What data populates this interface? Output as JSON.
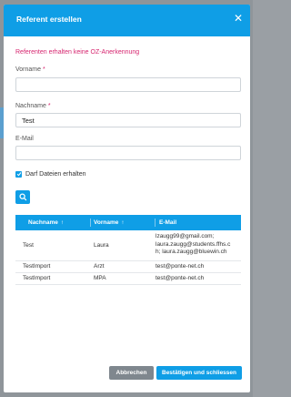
{
  "modal": {
    "title": "Referent erstellen",
    "close_icon": "close-icon",
    "warning": "Referenten erhalten keine OZ-Anerkennung"
  },
  "form": {
    "vorname": {
      "label": "Vorname",
      "required_mark": "*",
      "value": ""
    },
    "nachname": {
      "label": "Nachname",
      "required_mark": "*",
      "value": "Test"
    },
    "email": {
      "label": "E-Mail",
      "value": ""
    },
    "checkbox": {
      "label": "Darf Dateien erhalten",
      "checked": true
    }
  },
  "search_button": {
    "icon": "search-icon"
  },
  "table": {
    "headers": [
      {
        "label": "Nachname",
        "sort_icon": "↑"
      },
      {
        "label": "Vorname",
        "sort_icon": "↑"
      },
      {
        "label": "E-Mail"
      }
    ],
    "rows": [
      {
        "nachname": "Test",
        "vorname": "Laura",
        "email_lines": [
          "lzaugg99@gmail.com;",
          "laura.zaugg@students.ffhs.c",
          "h; laura.zaugg@bluewin.ch"
        ]
      },
      {
        "nachname": "TestImport",
        "vorname": "Arzt",
        "email_lines": [
          "test@ponte-net.ch"
        ]
      },
      {
        "nachname": "TestImport",
        "vorname": "MPA",
        "email_lines": [
          "test@ponte-net.ch"
        ]
      }
    ]
  },
  "footer": {
    "cancel_label": "Abbrechen",
    "confirm_label": "Bestätigen und schliessen"
  },
  "colors": {
    "accent": "#0f9ee6",
    "warning": "#d6246e",
    "cancel": "#7f878e"
  }
}
